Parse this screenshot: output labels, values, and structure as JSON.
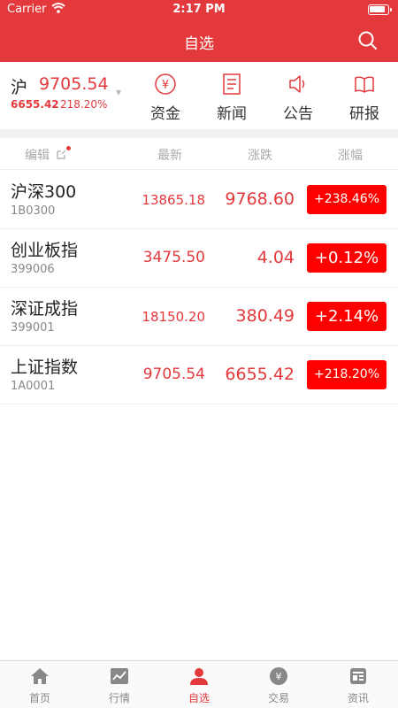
{
  "status_bar": {
    "carrier": "Carrier",
    "time": "2:17 PM"
  },
  "nav": {
    "title": "自选"
  },
  "index_summary": {
    "name": "沪",
    "value": "9705.54",
    "change": "6655.42",
    "change_pct": "218.20%"
  },
  "quick_links": [
    {
      "label": "资金",
      "icon": "yuan-coin-icon"
    },
    {
      "label": "新闻",
      "icon": "news-document-icon"
    },
    {
      "label": "公告",
      "icon": "speaker-icon"
    },
    {
      "label": "研报",
      "icon": "open-book-icon"
    }
  ],
  "columns": {
    "edit": "编辑",
    "latest": "最新",
    "change": "涨跌",
    "change_pct": "涨幅"
  },
  "watchlist": [
    {
      "name": "沪深300",
      "code": "1B0300",
      "latest": "13865.18",
      "change": "9768.60",
      "change_pct": "+238.46%"
    },
    {
      "name": "创业板指",
      "code": "399006",
      "latest": "3475.50",
      "change": "4.04",
      "change_pct": "+0.12%"
    },
    {
      "name": "深证成指",
      "code": "399001",
      "latest": "18150.20",
      "change": "380.49",
      "change_pct": "+2.14%"
    },
    {
      "name": "上证指数",
      "code": "1A0001",
      "latest": "9705.54",
      "change": "6655.42",
      "change_pct": "+218.20%"
    }
  ],
  "tabs": [
    {
      "label": "首页",
      "icon": "home-icon",
      "active": false
    },
    {
      "label": "行情",
      "icon": "chart-icon",
      "active": false
    },
    {
      "label": "自选",
      "icon": "person-icon",
      "active": true
    },
    {
      "label": "交易",
      "icon": "trade-yuan-icon",
      "active": false
    },
    {
      "label": "资讯",
      "icon": "newspaper-icon",
      "active": false
    }
  ],
  "colors": {
    "brand_red": "#e4393c",
    "badge_red": "#ff0000",
    "muted": "#aaaaaa"
  }
}
